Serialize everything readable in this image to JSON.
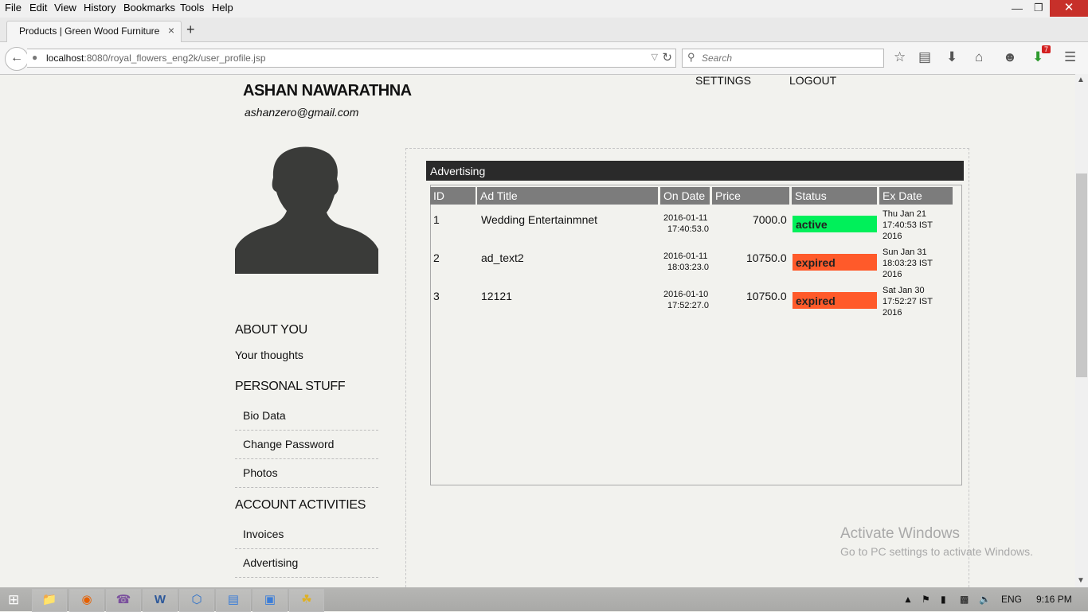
{
  "menu": [
    "File",
    "Edit",
    "View",
    "History",
    "Bookmarks",
    "Tools",
    "Help"
  ],
  "tab": {
    "title": "Products | Green Wood Furniture",
    "close": "×"
  },
  "newtab": "+",
  "url": {
    "host": "localhost",
    "rest": ":8080/royal_flowers_eng2k/user_profile.jsp"
  },
  "search": {
    "placeholder": "Search"
  },
  "notif_count": "7",
  "user": {
    "name": "ASHAN NAWARATHNA",
    "email": "ashanzero@gmail.com"
  },
  "top_links": {
    "settings": "SETTINGS",
    "logout": "LOGOUT"
  },
  "sidebar": {
    "about_title": "ABOUT YOU",
    "thoughts": "Your thoughts",
    "personal_title": "PERSONAL STUFF",
    "personal_items": [
      "Bio Data",
      "Change Password",
      "Photos"
    ],
    "account_title": "ACCOUNT ACTIVITIES",
    "account_items": [
      "Invoices",
      "Advertising"
    ]
  },
  "ads": {
    "title": "Advertising",
    "columns": [
      "ID",
      "Ad Title",
      "On Date",
      "Price",
      "Status",
      "Ex Date"
    ],
    "rows": [
      {
        "id": "1",
        "title": "Wedding Entertainmnet",
        "on_date_1": "2016-01-11",
        "on_date_2": "17:40:53.0",
        "price": "7000.0",
        "status": "active",
        "ex_1": "Thu Jan 21",
        "ex_2": "17:40:53 IST",
        "ex_3": "2016"
      },
      {
        "id": "2",
        "title": "ad_text2",
        "on_date_1": "2016-01-11",
        "on_date_2": "18:03:23.0",
        "price": "10750.0",
        "status": "expired",
        "ex_1": "Sun Jan 31",
        "ex_2": "18:03:23 IST",
        "ex_3": "2016"
      },
      {
        "id": "3",
        "title": "12121",
        "on_date_1": "2016-01-10",
        "on_date_2": "17:52:27.0",
        "price": "10750.0",
        "status": "expired",
        "ex_1": "Sat Jan 30",
        "ex_2": "17:52:27 IST",
        "ex_3": "2016"
      }
    ]
  },
  "watermark": {
    "line1": "Activate Windows",
    "line2": "Go to PC settings to activate Windows."
  },
  "tray": {
    "lang": "ENG",
    "time": "9:16 PM"
  },
  "colors": {
    "active": "#00f05a",
    "expired": "#ff5a2a",
    "header": "#2a2a2a"
  }
}
